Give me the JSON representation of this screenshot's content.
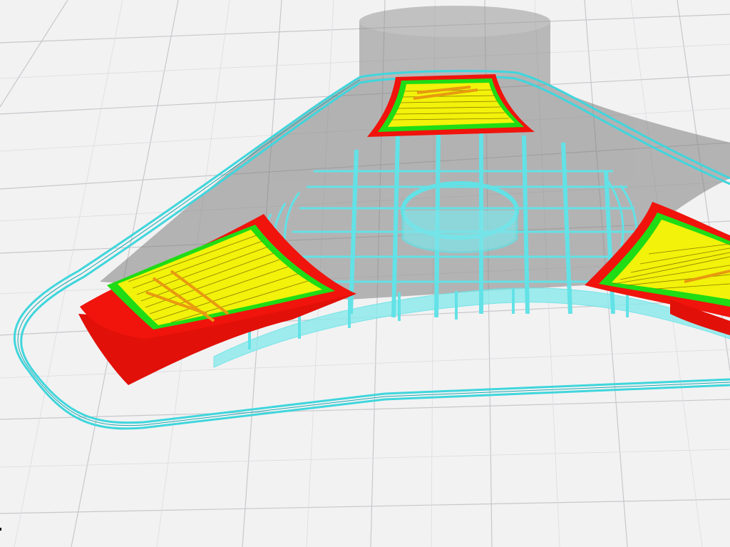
{
  "app": {
    "view": "layer-preview"
  },
  "colors": {
    "background": "#f2f2f3",
    "grid_line": "#c8c8cc",
    "ghost_model": "#7f7f7f",
    "travel_skirt": "#3fd6dc",
    "support_infill": "#62e2e6",
    "outer_wall": "#f0140c",
    "inner_wall": "#1fdc14",
    "top_bottom_skin": "#f2f20a",
    "infill_strand": "#e89a10"
  },
  "layers": [
    {
      "name": "outer-wall",
      "color_key": "outer_wall"
    },
    {
      "name": "inner-wall",
      "color_key": "inner_wall"
    },
    {
      "name": "top-bottom-skin",
      "color_key": "top_bottom_skin"
    },
    {
      "name": "infill",
      "color_key": "infill_strand"
    },
    {
      "name": "support",
      "color_key": "support_infill"
    },
    {
      "name": "skirt",
      "color_key": "travel_skirt"
    }
  ]
}
